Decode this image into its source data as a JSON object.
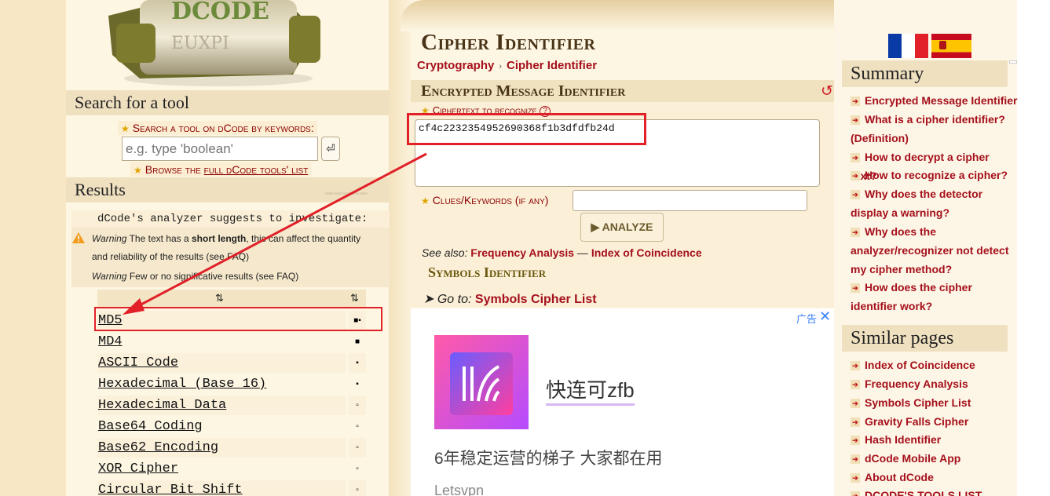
{
  "logo": {
    "letters_row1": "DCODE",
    "letters_row2": "EUXPI"
  },
  "left": {
    "search_head": "Search for a tool",
    "search_label": "Search a tool on dCode by keywords:",
    "search_placeholder": "e.g. type 'boolean'",
    "search_btn_glyph": "⏎",
    "browse_prefix": "Browse the",
    "browse_link": "full dCode tools' list",
    "results_head": "Results",
    "analyzer_text": "dCode's analyzer suggests to investigate:",
    "warning1_lead": "Warning",
    "warning1_text_a": "The text has a",
    "warning1_bold": "short length",
    "warning1_text_b": ", this can affect the quantity",
    "warning1_line2": "and reliability of the results (see FAQ)",
    "warning2_lead": "Warning",
    "warning2_text": "Few or no significative results (see FAQ)",
    "sort_glyph_1": "⇅",
    "sort_glyph_2": "⇅",
    "results": [
      {
        "name": "MD5",
        "score": "■▪"
      },
      {
        "name": "MD4",
        "score": "■"
      },
      {
        "name": "ASCII Code",
        "score": "▪"
      },
      {
        "name": "Hexadecimal (Base 16)",
        "score": "▪"
      },
      {
        "name": "Hexadecimal Data",
        "score": "▫"
      },
      {
        "name": "Base64 Coding",
        "score": "▫"
      },
      {
        "name": "Base62 Encoding",
        "score": "▫"
      },
      {
        "name": "XOR Cipher",
        "score": "▫"
      },
      {
        "name": "Circular Bit Shift",
        "score": "▫"
      }
    ]
  },
  "main": {
    "title": "Cipher Identifier",
    "breadcrumb": [
      "Cryptography",
      "Cipher Identifier"
    ],
    "breadcrumb_sep": "›",
    "tool_head": "Encrypted Message Identifier",
    "ciphertext_label": "Ciphertext to recognize",
    "help_glyph": "?",
    "ciphertext_value": "cf4c2232354952690368f1b3dfdfb24d",
    "clues_label": "Clues/Keywords (if any)",
    "analyze_label": "▶ ANALYZE",
    "see_also_label": "See also:",
    "see_also_links": [
      "Frequency Analysis",
      "Index of Coincidence"
    ],
    "see_also_sep": "—",
    "symbols_title": "Symbols Identifier",
    "goto_label": "➤ Go to:",
    "goto_link": "Symbols Cipher List",
    "reload_glyph": "↺"
  },
  "ad": {
    "label": "广告",
    "close": "✕",
    "title": "快连可zfb",
    "subtitle": "6年稳定运营的梯子 大家都在用",
    "brand": "Letsvpn"
  },
  "right": {
    "summary_head": "Summary",
    "summary_items": [
      "Encrypted Message Identifier",
      "What is a cipher identifier? (Definition)",
      "How to decrypt a cipher text?",
      "How to recognize a cipher?",
      "Why does the detector display a warning?",
      "Why does the analyzer/recognizer not detect my cipher method?",
      "How does the cipher identifier work?"
    ],
    "similar_head": "Similar pages",
    "similar_items": [
      "Index of Coincidence",
      "Frequency Analysis",
      "Symbols Cipher List",
      "Gravity Falls Cipher",
      "Hash Identifier",
      "dCode Mobile App",
      "About dCode",
      "DCODE'S TOOLS LIST"
    ],
    "bullet_glyph": "➔"
  },
  "colors": {
    "link": "#a5101c",
    "highlight": "#e12028",
    "heading": "#4a3418",
    "panel": "#fbefd7"
  }
}
